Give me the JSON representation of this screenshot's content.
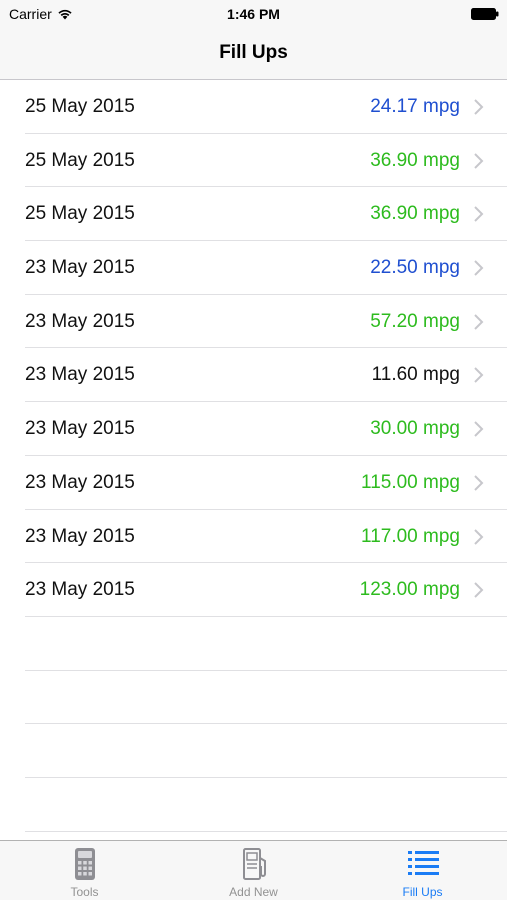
{
  "status_bar": {
    "carrier": "Carrier",
    "time": "1:46 PM"
  },
  "nav": {
    "title": "Fill Ups"
  },
  "colors": {
    "blue": "#1f4fd0",
    "green": "#2dbb1e",
    "black": "#111111",
    "tab_active": "#1a7cf5",
    "tab_inactive": "#929292"
  },
  "fillups": [
    {
      "date": "25 May 2015",
      "mpg": "24.17 mpg",
      "color": "blue"
    },
    {
      "date": "25 May 2015",
      "mpg": "36.90 mpg",
      "color": "green"
    },
    {
      "date": "25 May 2015",
      "mpg": "36.90 mpg",
      "color": "green"
    },
    {
      "date": "23 May 2015",
      "mpg": "22.50 mpg",
      "color": "blue"
    },
    {
      "date": "23 May 2015",
      "mpg": "57.20 mpg",
      "color": "green"
    },
    {
      "date": "23 May 2015",
      "mpg": "11.60 mpg",
      "color": "black"
    },
    {
      "date": "23 May 2015",
      "mpg": "30.00 mpg",
      "color": "green"
    },
    {
      "date": "23 May 2015",
      "mpg": "115.00 mpg",
      "color": "green"
    },
    {
      "date": "23 May 2015",
      "mpg": "117.00 mpg",
      "color": "green"
    },
    {
      "date": "23 May 2015",
      "mpg": "123.00 mpg",
      "color": "green"
    }
  ],
  "tabs": [
    {
      "label": "Tools",
      "icon": "calculator-icon",
      "active": false
    },
    {
      "label": "Add New",
      "icon": "gas-pump-icon",
      "active": false
    },
    {
      "label": "Fill Ups",
      "icon": "list-icon",
      "active": true
    }
  ]
}
